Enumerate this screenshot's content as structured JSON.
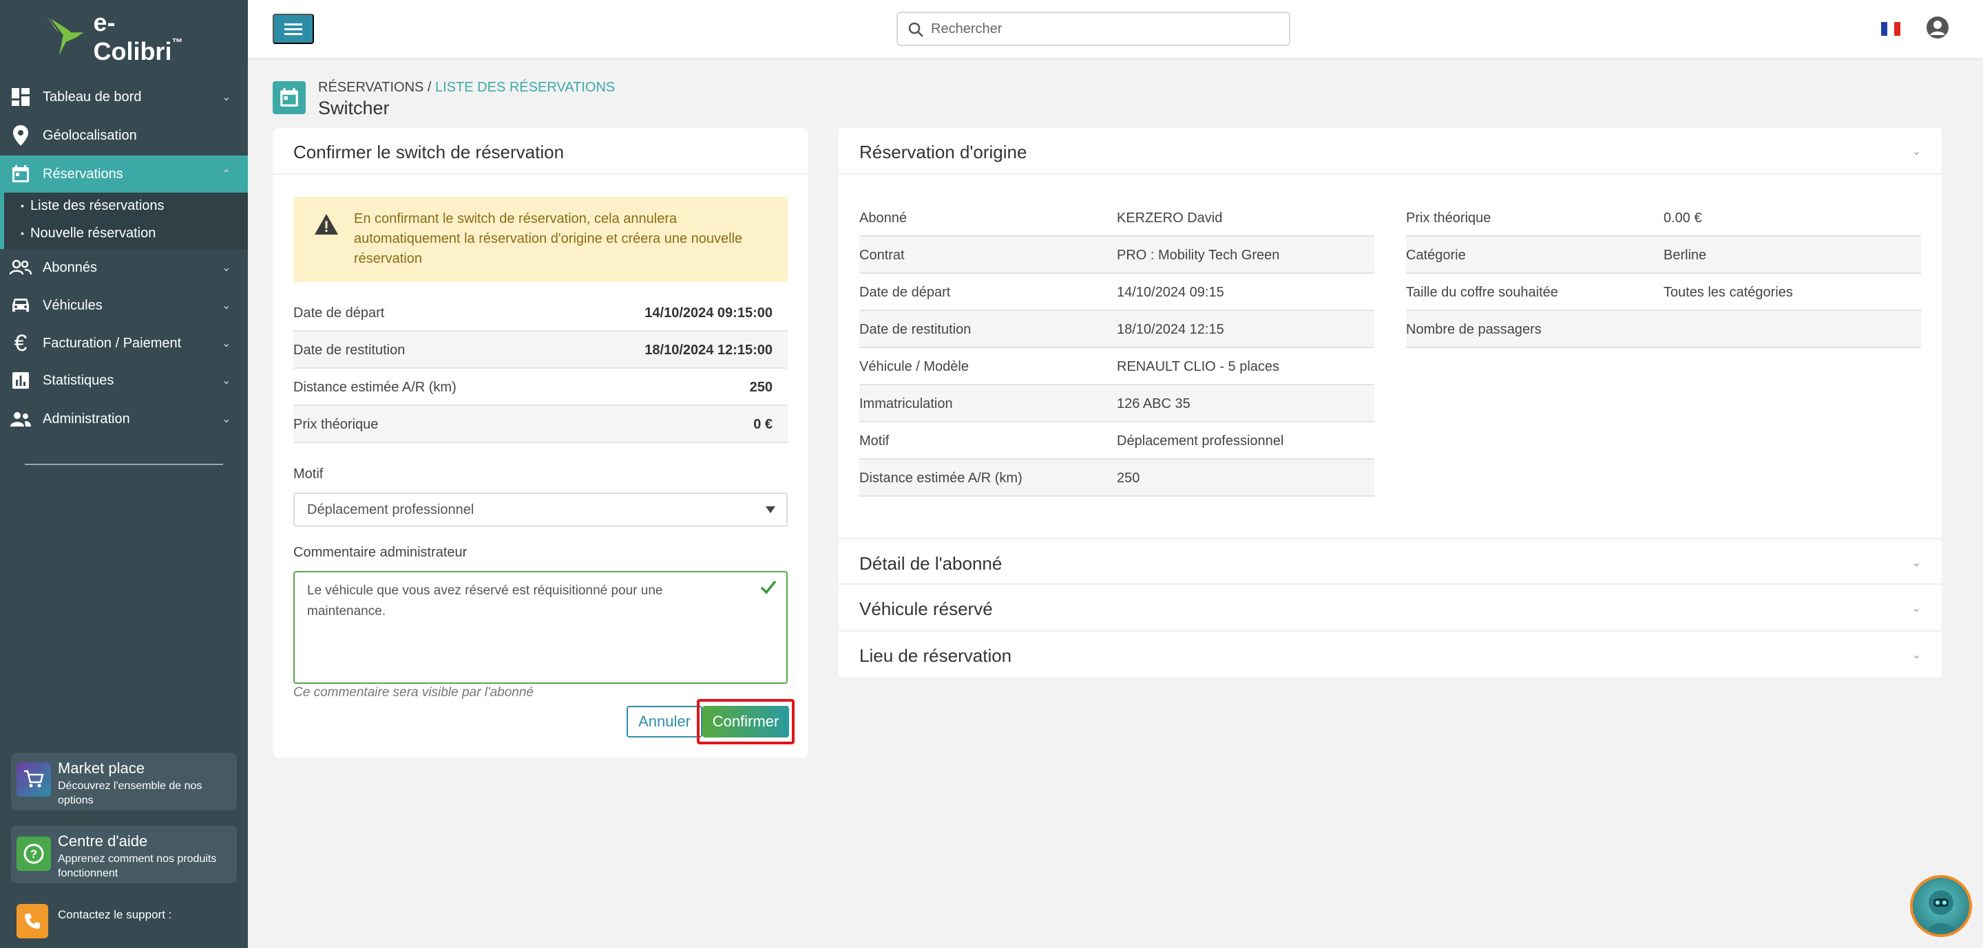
{
  "app": {
    "name": "e-Colibri"
  },
  "sidebar": {
    "items": [
      {
        "label": "Tableau de bord",
        "icon": "dashboard-icon"
      },
      {
        "label": "Géolocalisation",
        "icon": "location-pin-icon"
      },
      {
        "label": "Réservations",
        "icon": "calendar-icon"
      },
      {
        "label": "Abonnés",
        "icon": "users-icon"
      },
      {
        "label": "Véhicules",
        "icon": "car-icon"
      },
      {
        "label": "Facturation / Paiement",
        "icon": "euro-icon"
      },
      {
        "label": "Statistiques",
        "icon": "bar-chart-icon"
      },
      {
        "label": "Administration",
        "icon": "admin-users-icon"
      }
    ],
    "sub_items": [
      "Liste des réservations",
      "Nouvelle réservation"
    ],
    "marketplace": {
      "title": "Market place",
      "subtitle": "Découvrez l'ensemble de nos options"
    },
    "help": {
      "title": "Centre d'aide",
      "subtitle": "Apprenez comment nos produits fonctionnent"
    },
    "support": {
      "label": "Contactez le support :"
    }
  },
  "header": {
    "search_placeholder": "Rechercher",
    "language": "FR"
  },
  "breadcrumb": {
    "root": "RÉSERVATIONS",
    "separator": " / ",
    "link": "LISTE DES RÉSERVATIONS",
    "title": "Switcher"
  },
  "confirm_card": {
    "title": "Confirmer le switch de réservation",
    "warning": "En confirmant le switch de réservation, cela annulera automatiquement la réservation d'origine et créera une nouvelle réservation",
    "rows": [
      {
        "label": "Date de départ",
        "value": "14/10/2024 09:15:00"
      },
      {
        "label": "Date de restitution",
        "value": "18/10/2024 12:15:00"
      },
      {
        "label": "Distance estimée A/R (km)",
        "value": "250"
      },
      {
        "label": "Prix théorique",
        "value": "0 €"
      }
    ],
    "motif_label": "Motif",
    "motif_value": "Déplacement professionnel",
    "comment_label": "Commentaire administrateur",
    "comment_value": "Le véhicule que vous avez réservé est réquisitionné pour une maintenance.",
    "comment_hint": "Ce commentaire sera visible par l'abonné",
    "cancel_label": "Annuler",
    "confirm_label": "Confirmer"
  },
  "origin_card": {
    "title": "Réservation d'origine",
    "left_rows": [
      {
        "label": "Abonné",
        "value": "KERZERO David"
      },
      {
        "label": "Contrat",
        "value": "PRO : Mobility Tech Green"
      },
      {
        "label": "Date de départ",
        "value": "14/10/2024 09:15"
      },
      {
        "label": "Date de restitution",
        "value": "18/10/2024 12:15"
      },
      {
        "label": "Véhicule / Modèle",
        "value": "RENAULT CLIO - 5 places"
      },
      {
        "label": "Immatriculation",
        "value": "126 ABC 35"
      },
      {
        "label": "Motif",
        "value": "Déplacement professionnel"
      },
      {
        "label": "Distance estimée A/R (km)",
        "value": "250"
      }
    ],
    "right_rows": [
      {
        "label": "Prix théorique",
        "value": "0.00 €"
      },
      {
        "label": "Catégorie",
        "value": "Berline"
      },
      {
        "label": "Taille du coffre souhaitée",
        "value": "Toutes les catégories"
      },
      {
        "label": "Nombre de passagers",
        "value": ""
      }
    ],
    "sections": [
      "Détail de l'abonné",
      "Véhicule réservé",
      "Lieu de réservation"
    ]
  },
  "colors": {
    "sidebar": "#374a52",
    "accent": "#3da9a6",
    "primary": "#2e8ea8",
    "warning_bg": "#fdf1c9",
    "highlight": "#e0161c"
  }
}
